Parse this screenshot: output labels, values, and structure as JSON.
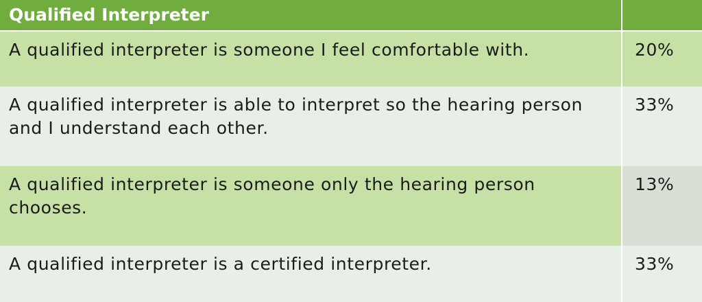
{
  "table": {
    "header": {
      "title": "Qualified Interpreter",
      "value": ""
    },
    "rows": [
      {
        "statement": "A qualified interpreter is someone I feel comfortable with.",
        "percent": "20%"
      },
      {
        "statement": "A qualified interpreter is able to interpret so the hearing person and I understand each other.",
        "percent": "33%"
      },
      {
        "statement": "A qualified interpreter is someone only the hearing person chooses.",
        "percent": "13%"
      },
      {
        "statement": "A qualified interpreter is a certified interpreter.",
        "percent": "33%"
      }
    ],
    "colors": {
      "header": "#70ad3e",
      "row_green": "#c6e0a5",
      "row_pale": "#e8efe6",
      "cell_grey": "#d8e0d6"
    }
  }
}
